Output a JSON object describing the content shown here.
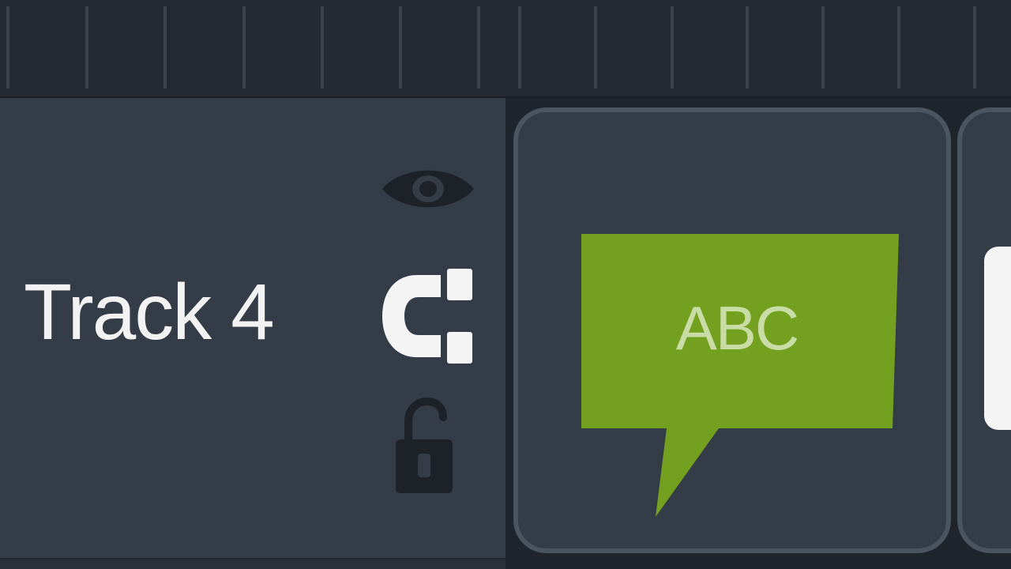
{
  "ruler": {
    "icon": "timeline-ruler"
  },
  "track": {
    "name": "Track 4",
    "icons": {
      "visibility": "eye-icon",
      "magnet": "magnet-icon",
      "lock": "unlocked-padlock-icon"
    }
  },
  "clip": {
    "type": "callout",
    "label": "ABC",
    "icon": "speech-bubble-icon",
    "colors": {
      "callout": "#74a01f",
      "clip_border": "#4b5562",
      "clip_background": "#343c47"
    }
  },
  "colors": {
    "track_header": "#343c47",
    "background": "#1f252d",
    "text": "#f2f2f2"
  }
}
